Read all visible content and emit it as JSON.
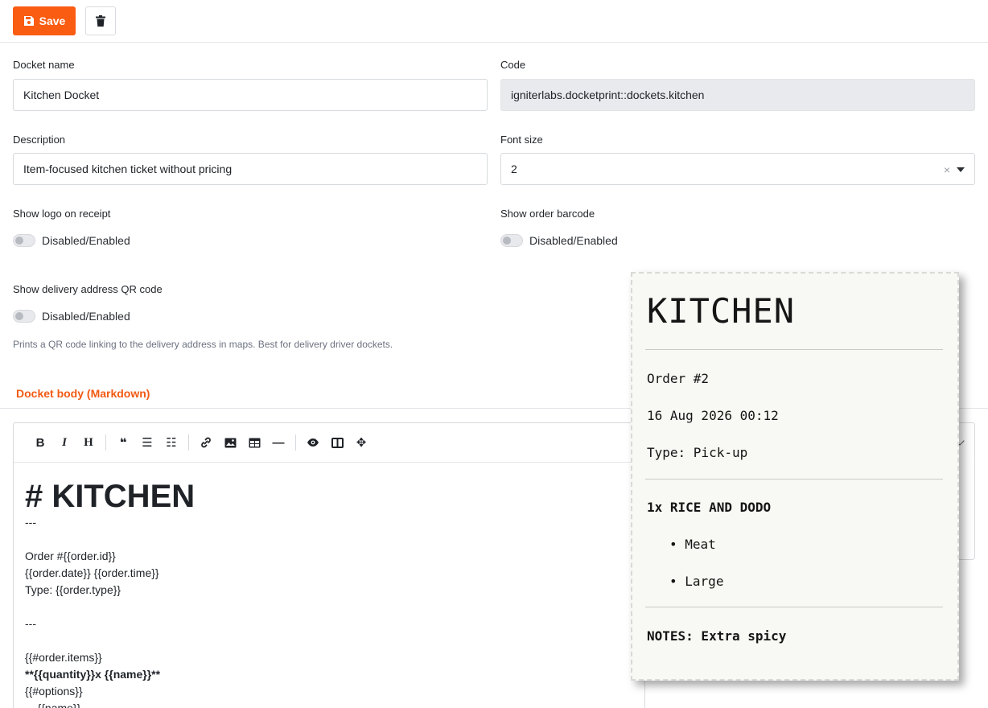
{
  "toolbar": {
    "save_label": "Save",
    "save_icon": "floppy-disk-icon",
    "delete_icon": "trash-icon",
    "accent_color": "#fa5c12"
  },
  "form": {
    "docket_name": {
      "label": "Docket name",
      "value": "Kitchen Docket"
    },
    "code": {
      "label": "Code",
      "value": "igniterlabs.docketprint::dockets.kitchen"
    },
    "description": {
      "label": "Description",
      "value": "Item-focused kitchen ticket without pricing"
    },
    "font_size": {
      "label": "Font size",
      "value": "2",
      "clear_glyph": "×"
    },
    "show_logo": {
      "label": "Show logo on receipt",
      "toggle_label": "Disabled/Enabled",
      "enabled": false
    },
    "show_barcode": {
      "label": "Show order barcode",
      "toggle_label": "Disabled/Enabled",
      "enabled": false
    },
    "show_qr": {
      "label": "Show delivery address QR code",
      "toggle_label": "Disabled/Enabled",
      "enabled": false,
      "help": "Prints a QR code linking to the delivery address in maps. Best for delivery driver dockets."
    }
  },
  "section": {
    "tab_label": "Docket body (Markdown)"
  },
  "editor": {
    "toolbar": {
      "bold": "B",
      "italic": "I",
      "heading": "H",
      "quote": "❝",
      "ul": "☰",
      "ol": "☷",
      "link": "🔗",
      "image": "▣",
      "table": "⊞",
      "hr": "—",
      "preview": "◉",
      "side_by_side": "◫",
      "fullscreen": "✥"
    },
    "content": {
      "heading": "# KITCHEN",
      "lines": [
        "---",
        "",
        "Order #{{order.id}}",
        "{{order.date}} {{order.time}}",
        "Type: {{order.type}}",
        "",
        "---",
        "",
        "{{#order.items}}"
      ],
      "bold_line": "**{{quantity}}x {{name}}**",
      "after_lines": [
        "{{#options}}",
        "    {{name}}"
      ]
    }
  },
  "receipt": {
    "title": "KITCHEN",
    "order": "Order #2",
    "datetime": "16 Aug 2026 00:12",
    "type": "Type: Pick-up",
    "item": "1x RICE AND DODO",
    "options": [
      "Meat",
      "Large"
    ],
    "bullet": "•",
    "notes": "NOTES: Extra spicy"
  }
}
